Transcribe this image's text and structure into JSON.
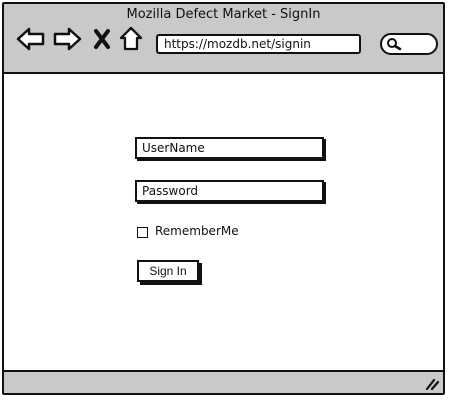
{
  "window": {
    "title": "Mozilla Defect Market - SignIn"
  },
  "toolbar": {
    "back_icon": "back-arrow-icon",
    "forward_icon": "forward-arrow-icon",
    "stop_icon": "close-icon",
    "home_icon": "home-icon",
    "search_icon": "search-icon"
  },
  "address_bar": {
    "url": "https://mozdb.net/signin"
  },
  "form": {
    "username_value": "UserName",
    "password_value": "Password",
    "remember_label": "RememberMe",
    "remember_checked": false,
    "signin_label": "Sign In"
  },
  "colors": {
    "chrome_gray": "#c9c9c9",
    "outline": "#111111"
  }
}
